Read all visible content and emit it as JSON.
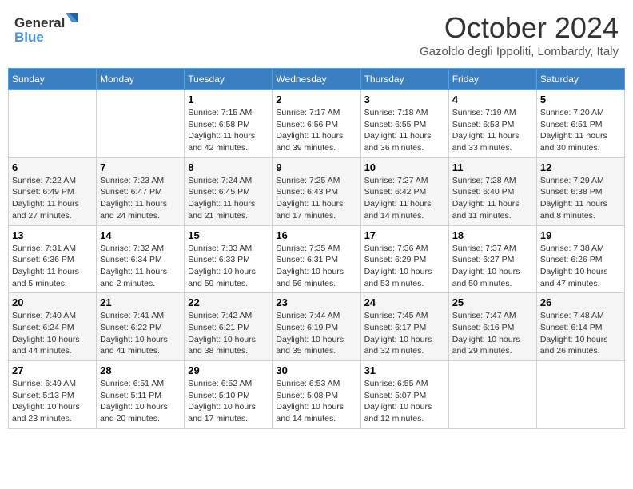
{
  "header": {
    "logo_line1": "General",
    "logo_line2": "Blue",
    "month": "October 2024",
    "location": "Gazoldo degli Ippoliti, Lombardy, Italy"
  },
  "columns": [
    "Sunday",
    "Monday",
    "Tuesday",
    "Wednesday",
    "Thursday",
    "Friday",
    "Saturday"
  ],
  "weeks": [
    [
      {
        "day": "",
        "info": ""
      },
      {
        "day": "",
        "info": ""
      },
      {
        "day": "1",
        "info": "Sunrise: 7:15 AM\nSunset: 6:58 PM\nDaylight: 11 hours and 42 minutes."
      },
      {
        "day": "2",
        "info": "Sunrise: 7:17 AM\nSunset: 6:56 PM\nDaylight: 11 hours and 39 minutes."
      },
      {
        "day": "3",
        "info": "Sunrise: 7:18 AM\nSunset: 6:55 PM\nDaylight: 11 hours and 36 minutes."
      },
      {
        "day": "4",
        "info": "Sunrise: 7:19 AM\nSunset: 6:53 PM\nDaylight: 11 hours and 33 minutes."
      },
      {
        "day": "5",
        "info": "Sunrise: 7:20 AM\nSunset: 6:51 PM\nDaylight: 11 hours and 30 minutes."
      }
    ],
    [
      {
        "day": "6",
        "info": "Sunrise: 7:22 AM\nSunset: 6:49 PM\nDaylight: 11 hours and 27 minutes."
      },
      {
        "day": "7",
        "info": "Sunrise: 7:23 AM\nSunset: 6:47 PM\nDaylight: 11 hours and 24 minutes."
      },
      {
        "day": "8",
        "info": "Sunrise: 7:24 AM\nSunset: 6:45 PM\nDaylight: 11 hours and 21 minutes."
      },
      {
        "day": "9",
        "info": "Sunrise: 7:25 AM\nSunset: 6:43 PM\nDaylight: 11 hours and 17 minutes."
      },
      {
        "day": "10",
        "info": "Sunrise: 7:27 AM\nSunset: 6:42 PM\nDaylight: 11 hours and 14 minutes."
      },
      {
        "day": "11",
        "info": "Sunrise: 7:28 AM\nSunset: 6:40 PM\nDaylight: 11 hours and 11 minutes."
      },
      {
        "day": "12",
        "info": "Sunrise: 7:29 AM\nSunset: 6:38 PM\nDaylight: 11 hours and 8 minutes."
      }
    ],
    [
      {
        "day": "13",
        "info": "Sunrise: 7:31 AM\nSunset: 6:36 PM\nDaylight: 11 hours and 5 minutes."
      },
      {
        "day": "14",
        "info": "Sunrise: 7:32 AM\nSunset: 6:34 PM\nDaylight: 11 hours and 2 minutes."
      },
      {
        "day": "15",
        "info": "Sunrise: 7:33 AM\nSunset: 6:33 PM\nDaylight: 10 hours and 59 minutes."
      },
      {
        "day": "16",
        "info": "Sunrise: 7:35 AM\nSunset: 6:31 PM\nDaylight: 10 hours and 56 minutes."
      },
      {
        "day": "17",
        "info": "Sunrise: 7:36 AM\nSunset: 6:29 PM\nDaylight: 10 hours and 53 minutes."
      },
      {
        "day": "18",
        "info": "Sunrise: 7:37 AM\nSunset: 6:27 PM\nDaylight: 10 hours and 50 minutes."
      },
      {
        "day": "19",
        "info": "Sunrise: 7:38 AM\nSunset: 6:26 PM\nDaylight: 10 hours and 47 minutes."
      }
    ],
    [
      {
        "day": "20",
        "info": "Sunrise: 7:40 AM\nSunset: 6:24 PM\nDaylight: 10 hours and 44 minutes."
      },
      {
        "day": "21",
        "info": "Sunrise: 7:41 AM\nSunset: 6:22 PM\nDaylight: 10 hours and 41 minutes."
      },
      {
        "day": "22",
        "info": "Sunrise: 7:42 AM\nSunset: 6:21 PM\nDaylight: 10 hours and 38 minutes."
      },
      {
        "day": "23",
        "info": "Sunrise: 7:44 AM\nSunset: 6:19 PM\nDaylight: 10 hours and 35 minutes."
      },
      {
        "day": "24",
        "info": "Sunrise: 7:45 AM\nSunset: 6:17 PM\nDaylight: 10 hours and 32 minutes."
      },
      {
        "day": "25",
        "info": "Sunrise: 7:47 AM\nSunset: 6:16 PM\nDaylight: 10 hours and 29 minutes."
      },
      {
        "day": "26",
        "info": "Sunrise: 7:48 AM\nSunset: 6:14 PM\nDaylight: 10 hours and 26 minutes."
      }
    ],
    [
      {
        "day": "27",
        "info": "Sunrise: 6:49 AM\nSunset: 5:13 PM\nDaylight: 10 hours and 23 minutes."
      },
      {
        "day": "28",
        "info": "Sunrise: 6:51 AM\nSunset: 5:11 PM\nDaylight: 10 hours and 20 minutes."
      },
      {
        "day": "29",
        "info": "Sunrise: 6:52 AM\nSunset: 5:10 PM\nDaylight: 10 hours and 17 minutes."
      },
      {
        "day": "30",
        "info": "Sunrise: 6:53 AM\nSunset: 5:08 PM\nDaylight: 10 hours and 14 minutes."
      },
      {
        "day": "31",
        "info": "Sunrise: 6:55 AM\nSunset: 5:07 PM\nDaylight: 10 hours and 12 minutes."
      },
      {
        "day": "",
        "info": ""
      },
      {
        "day": "",
        "info": ""
      }
    ]
  ]
}
